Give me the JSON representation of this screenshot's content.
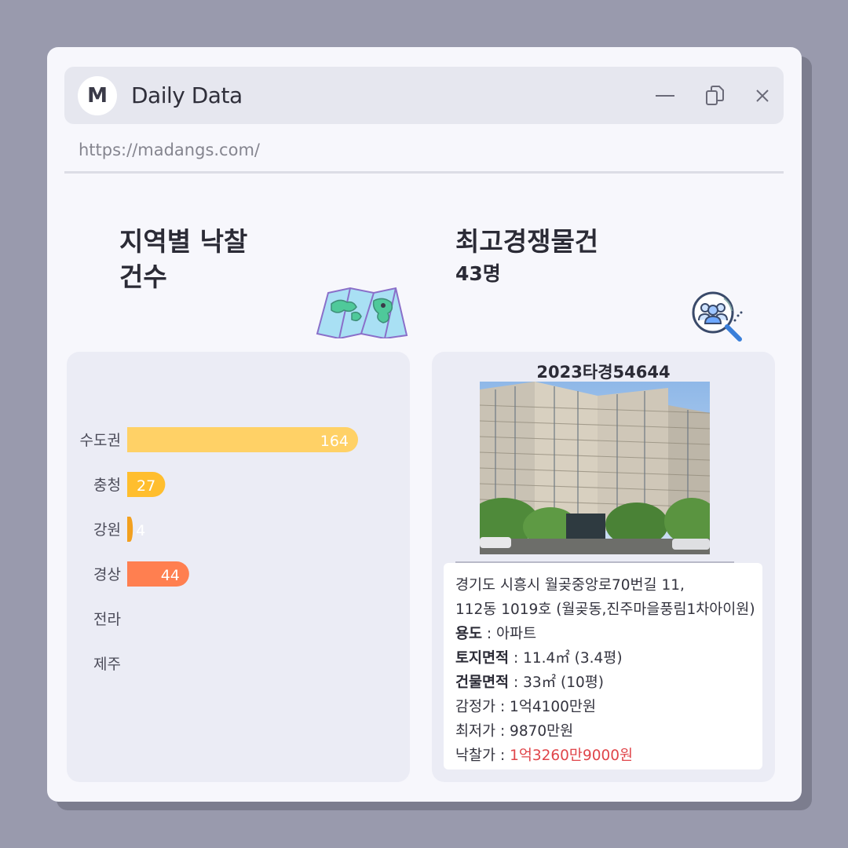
{
  "window": {
    "logo_letter": "M",
    "title": "Daily Data",
    "url": "https://madangs.com/"
  },
  "left": {
    "heading_line1": "지역별 낙찰",
    "heading_line2": "건수",
    "icon": "map-icon"
  },
  "right": {
    "heading": "최고경쟁물건",
    "subheading": "43명",
    "icon": "people-search-icon"
  },
  "chart_data": {
    "type": "bar",
    "orientation": "horizontal",
    "categories": [
      "수도권",
      "충청",
      "강원",
      "경상",
      "전라",
      "제주"
    ],
    "values": [
      164,
      27,
      4,
      44,
      null,
      null
    ],
    "value_labels": [
      "164",
      "27",
      "4",
      "44",
      "",
      ""
    ],
    "colors": [
      "#ffd166",
      "#ffbe2e",
      "#f2a01f",
      "#ff7f50",
      "#cccccc",
      "#cccccc"
    ]
  },
  "property": {
    "case_number": "2023타경54644",
    "address_line1": "경기도 시흥시 월곶중앙로70번길 11,",
    "address_line2": "112동 1019호 (월곶동,진주마을풍림1차아이원)",
    "usage_label": "용도",
    "usage_value": " : 아파트",
    "land_label": "토지면적",
    "land_value": " : 11.4㎡ (3.4평)",
    "building_label": "건물면적",
    "building_value": " : 33㎡ (10평)",
    "appraisal": "감정가 : 1억4100만원",
    "minimum": "최저가 : 9870만원",
    "winning_label": "낙찰가 : ",
    "winning_value": "1억3260만9000원",
    "winning_color": "#e0454a"
  }
}
